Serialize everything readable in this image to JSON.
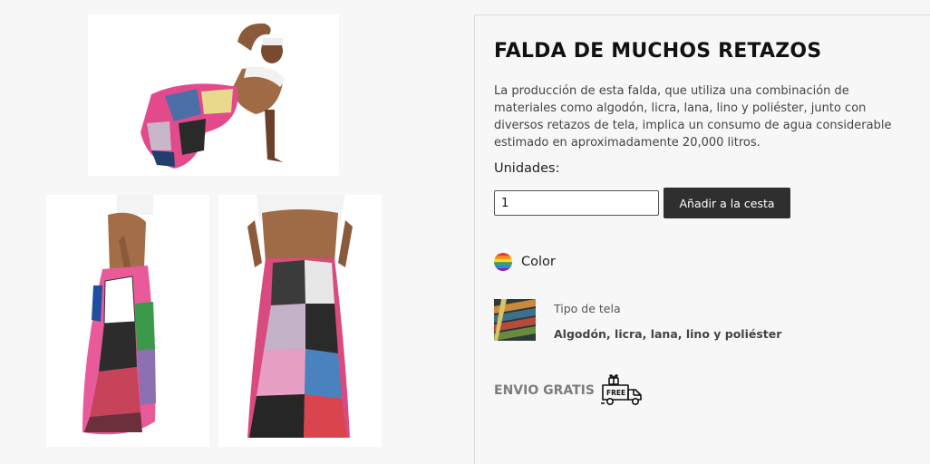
{
  "product": {
    "title": "FALDA DE MUCHOS RETAZOS",
    "description": "La producción de esta falda, que utiliza una combinación de materiales como algodón, licra, lana, lino y poliéster, junto con diversos retazos de tela, implica un consumo de agua considerable estimado en aproximadamente 20,000 litros.",
    "units_label": "Unidades:",
    "quantity_value": "1",
    "add_to_cart_label": "Añadir a la cesta",
    "color_label": "Color",
    "fabric_label": "Tipo de tela",
    "fabric_value": "Algodón, licra, lana, lino y poliéster",
    "shipping_label": "ENVIO GRATIS",
    "shipping_badge_text": "FREE"
  },
  "gallery": {
    "images": [
      "photo-main",
      "photo-side",
      "photo-back"
    ]
  },
  "icons": {
    "color": "rainbow-color-swatch-icon",
    "shipping": "free-delivery-truck-icon"
  },
  "colors": {
    "background": "#f7f7f7",
    "button_bg": "#2f2f2f",
    "button_text": "#ffffff",
    "muted_text": "#7d7d7d"
  }
}
